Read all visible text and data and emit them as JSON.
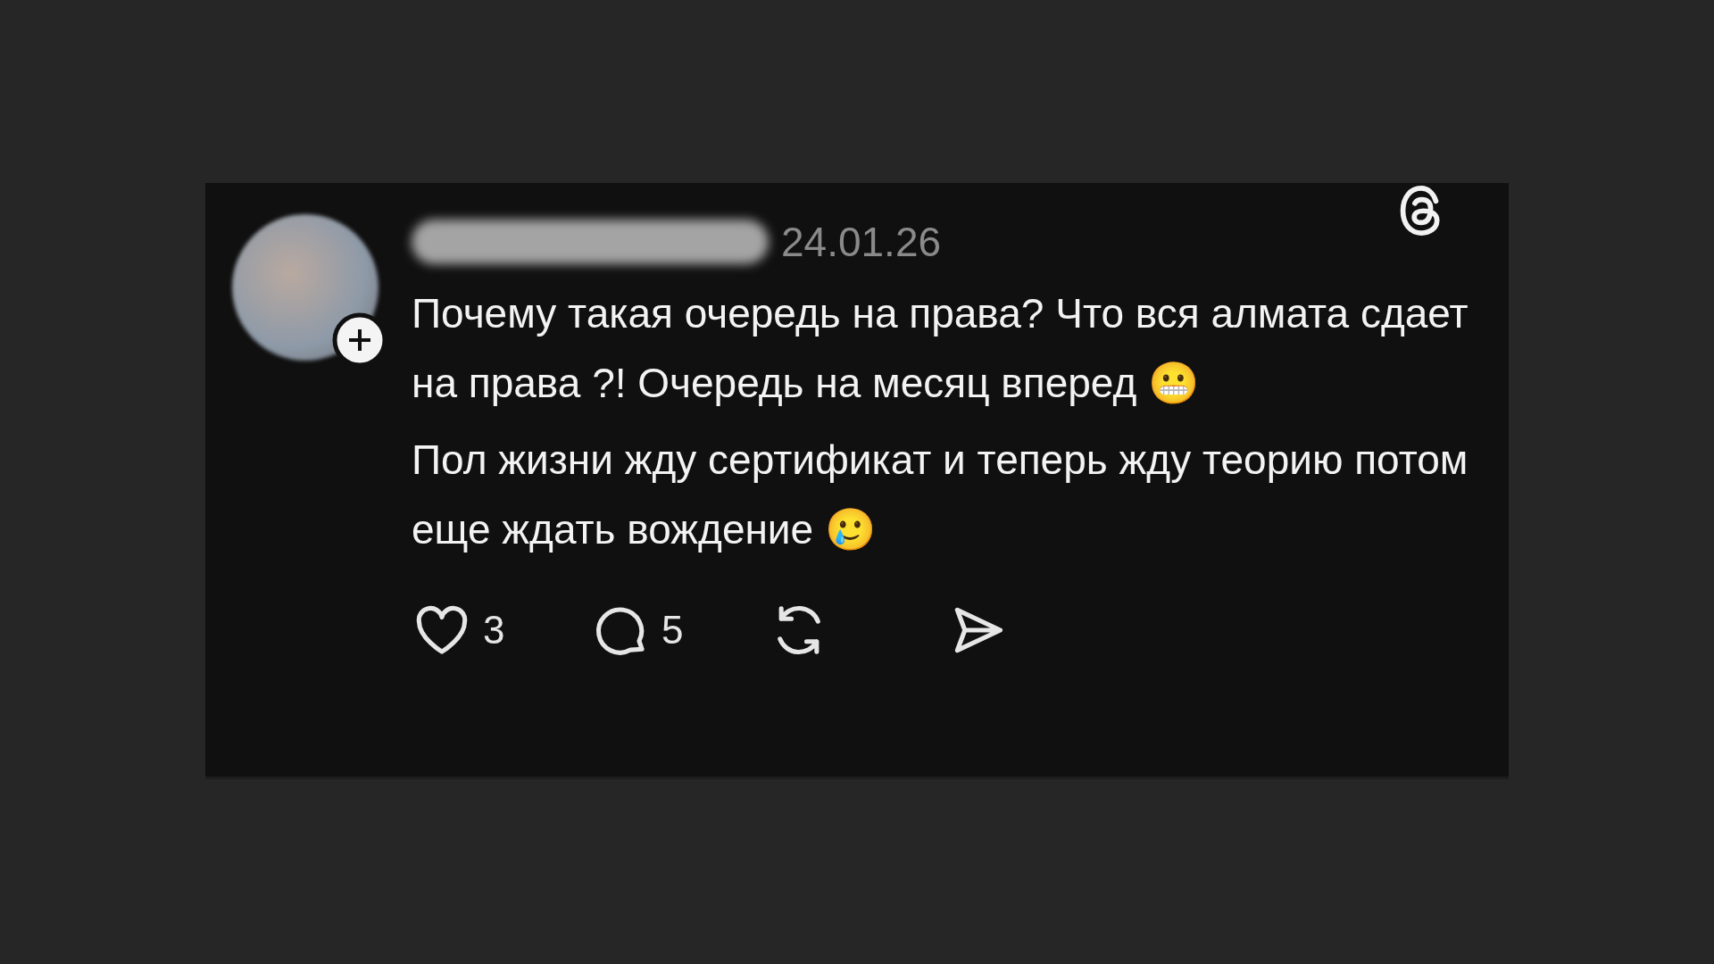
{
  "post": {
    "date": "24.01.26",
    "paragraphs": [
      "Почему такая очередь на права? Что вся алмата сдает на права ?! Очередь на месяц вперед 😬",
      "Пол жизни жду сертификат и теперь жду теорию потом еще ждать вождение 🥲"
    ],
    "actions": [
      {
        "kind": "like",
        "count": "3"
      },
      {
        "kind": "reply",
        "count": "5"
      },
      {
        "kind": "repost"
      },
      {
        "kind": "share"
      }
    ]
  }
}
